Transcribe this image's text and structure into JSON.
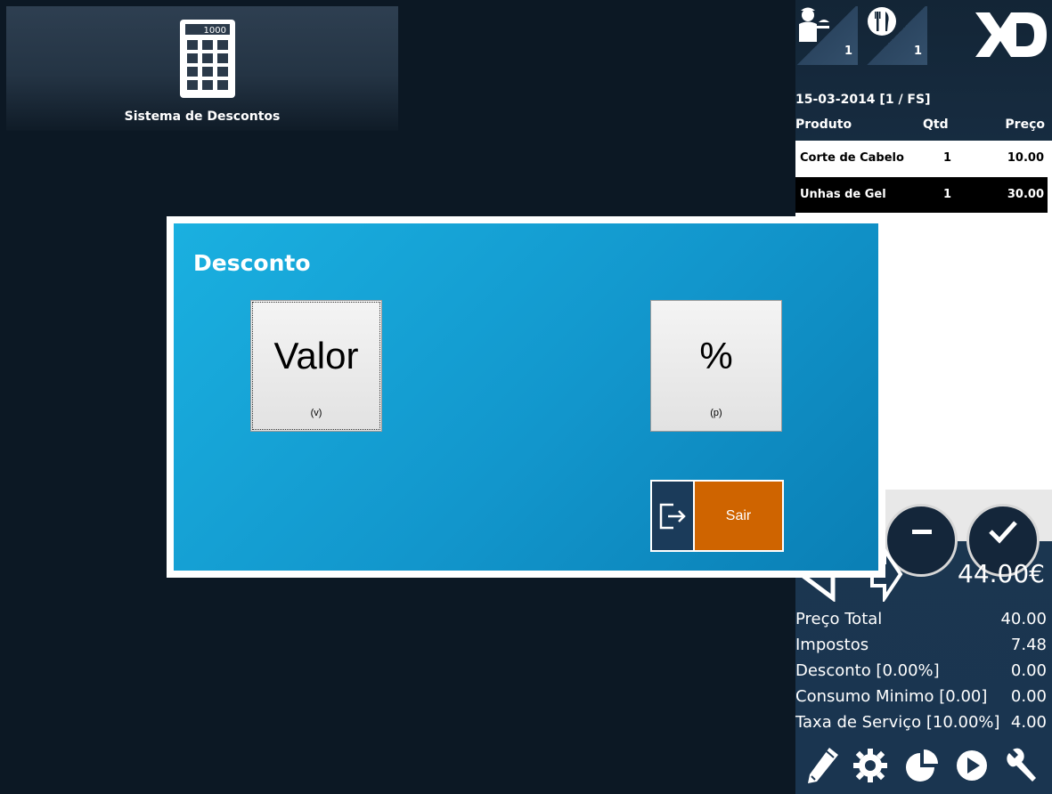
{
  "app_tile": {
    "label": "Sistema de Descontos",
    "calc_display": "1000"
  },
  "header_badges": [
    {
      "icon": "waiter-icon",
      "count": "1"
    },
    {
      "icon": "cutlery-icon",
      "count": "1"
    }
  ],
  "logo_text": "XD",
  "order": {
    "header": "15-03-2014 [1 / FS]",
    "columns": {
      "product": "Produto",
      "qty": "Qtd",
      "price": "Preço"
    },
    "rows": [
      {
        "product": "Corte de Cabelo",
        "qty": "1",
        "price": "10.00"
      },
      {
        "product": "Unhas de Gel",
        "qty": "1",
        "price": "30.00"
      }
    ]
  },
  "grand_total": "44.00€",
  "summary": [
    {
      "label": "Preço Total",
      "value": "40.00"
    },
    {
      "label": "Impostos",
      "value": "7.48"
    },
    {
      "label": "Desconto [0.00%]",
      "value": "0.00"
    },
    {
      "label": "Consumo Minimo [0.00]",
      "value": "0.00"
    },
    {
      "label": "Taxa de Serviço [10.00%]",
      "value": "4.00"
    }
  ],
  "modal": {
    "title": "Desconto",
    "value_button": {
      "label": "Valor",
      "shortcut": "(v)"
    },
    "percent_button": {
      "label": "%",
      "shortcut": "(p)"
    },
    "exit_button": {
      "label": "Sair"
    }
  },
  "colors": {
    "background": "#0c1824",
    "modal_blue": "#1296cc",
    "exit_orange": "#cf6400",
    "exit_icon_bg": "#1b3b5a"
  }
}
